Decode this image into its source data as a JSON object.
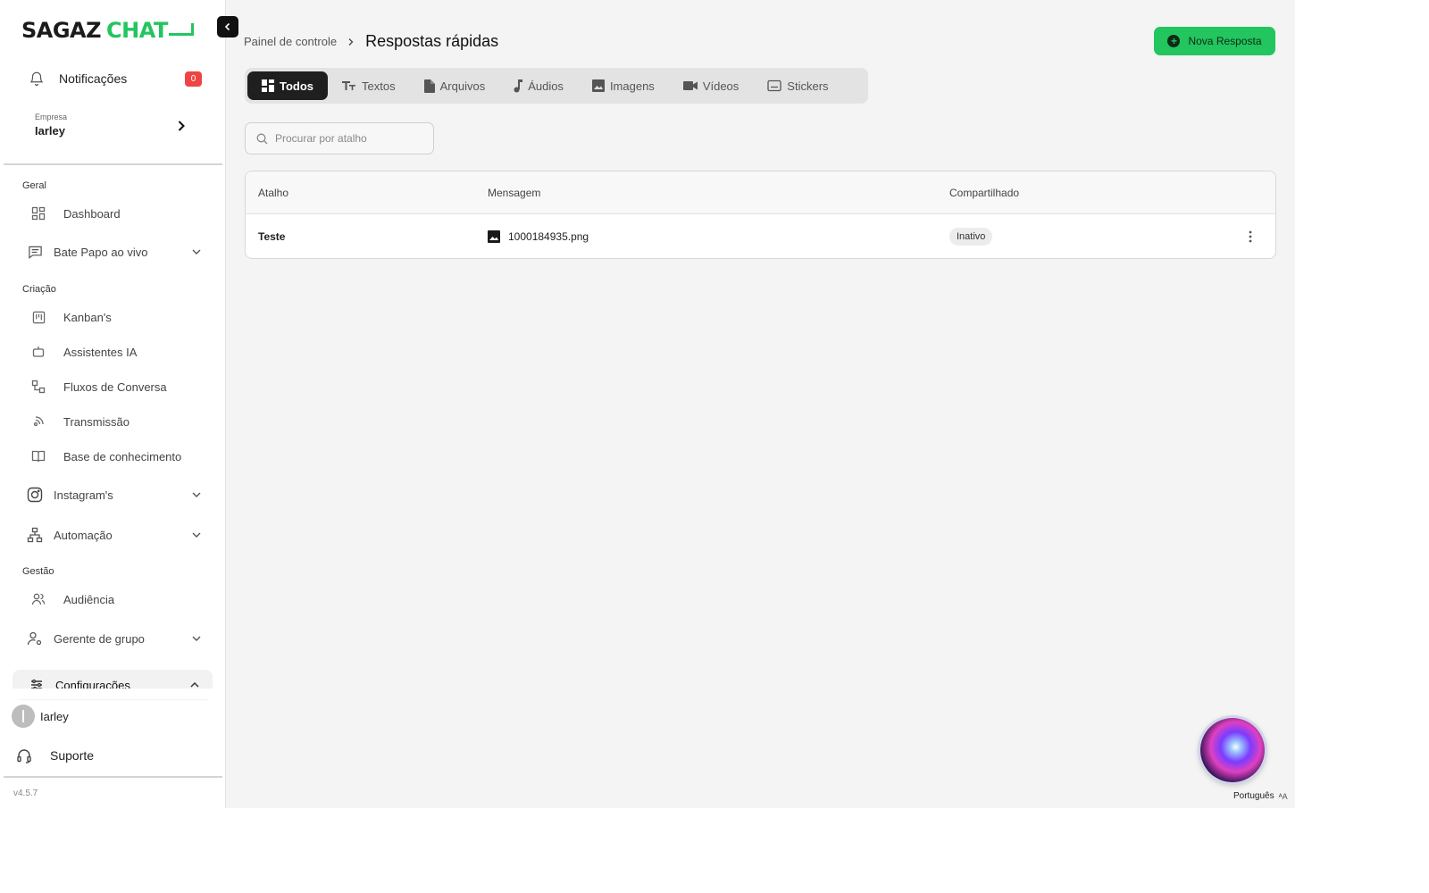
{
  "brand": {
    "word1": "SAGAZ",
    "word2": "CHAT",
    "accent": "#22c55e"
  },
  "notifications": {
    "label": "Notificações",
    "count": "0"
  },
  "company": {
    "caption": "Empresa",
    "name": "Iarley"
  },
  "sidebar": {
    "sections": {
      "geral": "Geral",
      "criacao": "Criação",
      "gestao": "Gestão"
    },
    "items": {
      "dashboard": "Dashboard",
      "bate_papo": "Bate Papo ao vivo",
      "kanban": "Kanban's",
      "assistentes": "Assistentes IA",
      "fluxos": "Fluxos de Conversa",
      "transmissao": "Transmissão",
      "base": "Base de conhecimento",
      "instagram": "Instagram's",
      "automacao": "Automação",
      "audiencia": "Audiência",
      "gerente": "Gerente de grupo",
      "configuracoes": "Configurações"
    }
  },
  "user": {
    "name": "Iarley"
  },
  "support": {
    "label": "Suporte"
  },
  "version": "v4.5.7",
  "breadcrumb": {
    "parent": "Painel de controle",
    "current": "Respostas rápidas"
  },
  "new_button": {
    "label": "Nova Resposta"
  },
  "tabs": {
    "todos": "Todos",
    "textos": "Textos",
    "arquivos": "Arquivos",
    "audios": "Áudios",
    "imagens": "Imagens",
    "videos": "Vídeos",
    "stickers": "Stickers"
  },
  "search": {
    "placeholder": "Procurar por atalho",
    "value": ""
  },
  "table": {
    "headers": {
      "atalho": "Atalho",
      "mensagem": "Mensagem",
      "compartilhado": "Compartilhado"
    },
    "rows": [
      {
        "atalho": "Teste",
        "mensagem": "1000184935.png",
        "compartilhado": "Inativo"
      }
    ]
  },
  "language": {
    "label": "Português"
  }
}
